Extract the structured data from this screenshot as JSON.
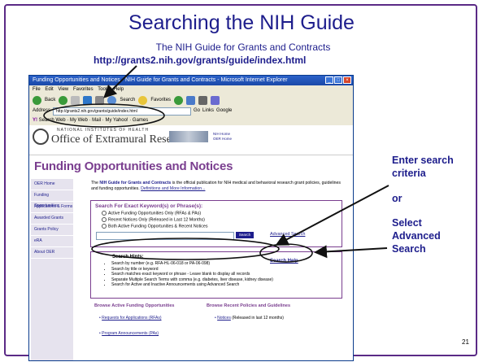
{
  "slide": {
    "title": "Searching the NIH Guide",
    "subtitle": "The NIH Guide for Grants and Contracts",
    "url": "http://grants2.nih.gov/grants/guide/index.html",
    "callouts": [
      "Enter search",
      "criteria",
      "or",
      "Select",
      "Advanced",
      "Search"
    ],
    "slide_number": "21",
    "colors": {
      "title": "#1d1d8c",
      "frame": "#5b2a86",
      "accent": "#7a3e8f"
    }
  },
  "browser": {
    "window_title": "Funding Opportunities and Notices - NIH Guide for Grants and Contracts - Microsoft Internet Explorer",
    "menu": [
      "File",
      "Edit",
      "View",
      "Favorites",
      "Tools",
      "Help"
    ],
    "toolbar": {
      "back": "Back",
      "search": "Search",
      "favorites": "Favorites"
    },
    "address_label": "Address",
    "address_value": "http://grants2.nih.gov/grants/guide/index.html",
    "go_label": "Go",
    "links_label": "Links",
    "google_label": "Google",
    "links_bar": "Search Web · My Web · Mail · My Yahoo! · Games"
  },
  "page": {
    "nih_text": "NATIONAL INSTITUTES OF HEALTH",
    "oer_name": "Office of Extramural Research",
    "header_links": [
      "NIH Home",
      "OER Home"
    ],
    "title": "Funding Opportunities and Notices",
    "sidebar": [
      "OER Home",
      "Funding Opportunities",
      "Applications & Forms",
      "Awarded Grants",
      "Grants Policy",
      "eRA",
      "About OER"
    ],
    "intro_bold": "NIH Guide for Grants and Contracts",
    "intro_rest": "is the official publication for NIH medical and behavioral research grant policies, guidelines and funding opportunities.",
    "intro_link": "Definitions and More Information...",
    "intro_the": "The",
    "search_heading": "Search For Exact Keyword(s) or Phrase(s):",
    "search_options": [
      "Active Funding Opportunities Only (RFAs & PAs)",
      "Recent Notices Only (Released in Last 12 Months)",
      "Both Active Funding Opportunities & Recent Notices"
    ],
    "search_button": "Search",
    "advanced_search": "Advanced Search",
    "hints_title": "Search Hints:",
    "hints": [
      "Search by number (e.g. RFA-HL-06-018 or PA-06-098)",
      "Search by title or keyword",
      "Search matches exact keyword or phrase - Leave blank to display all records",
      "Separate Multiple Search Terms with comma (e.g. diabetes, liver disease, kidney disease)",
      "Search for Active and Inactive Announcements using Advanced Search"
    ],
    "search_help": "Search Help",
    "browse_active": "Browse Active Funding Opportunities",
    "browse_recent": "Browse Recent Policies and Guidelines",
    "rfa_link": "Requests for Applications (RFAs)",
    "pa_link": "Program Announcements (PAs)",
    "notices_link": "Notices",
    "notices_note": "(Released in last 12 months)"
  }
}
